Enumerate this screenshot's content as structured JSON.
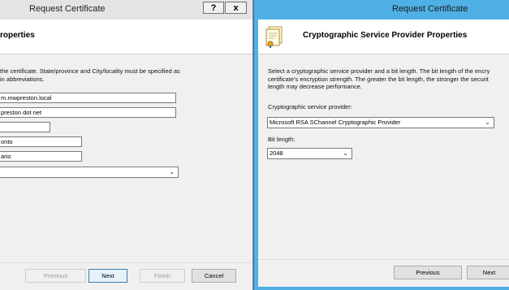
{
  "left_window": {
    "title": "Request Certificate",
    "help_btn": "?",
    "close_btn": "x",
    "header_title": "roperties",
    "description": "the certificate. State/province and City/locality must be specified as\nin abbreviations.",
    "fields": [
      {
        "value": "m.mwpreston.local"
      },
      {
        "value": "preston dot net"
      },
      {
        "value": ""
      },
      {
        "value": "onto"
      },
      {
        "value": "ario"
      }
    ],
    "country_select": {
      "value": ""
    },
    "buttons": {
      "previous": "Previous",
      "next": "Next",
      "finish": "Finish",
      "cancel": "Cancel"
    }
  },
  "right_window": {
    "title": "Request Certificate",
    "header_title": "Cryptographic Service Provider Properties",
    "description": "Select a cryptographic service provider and a bit length. The bit length of the encry\ncertificate's encryption strength. The greater the bit length, the stronger the securit\nlength may decrease performance.",
    "csp_label": "Cryptographic service provider:",
    "csp_value": "Microsoft RSA SChannel Cryptographic Provider",
    "bit_label": "Bit length:",
    "bit_value": "2048",
    "buttons": {
      "previous": "Previous",
      "next": "Next"
    },
    "icon": "certificate-icon"
  }
}
